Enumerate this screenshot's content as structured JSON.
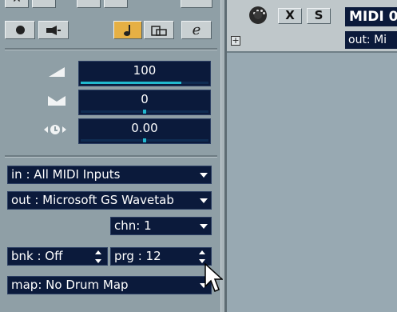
{
  "inspector": {
    "top_buttons": [
      {
        "name": "record-enable-icon",
        "glyph": "●"
      },
      {
        "name": "monitor-icon",
        "glyph": "▸"
      },
      {
        "name": "note-icon",
        "glyph": "♪"
      },
      {
        "name": "lock-icon",
        "glyph": "⊓"
      },
      {
        "name": "edit-icon",
        "glyph": "e"
      }
    ],
    "volume": {
      "value": "100",
      "level": 0.79
    },
    "pan": {
      "value": "0",
      "level": 0.5
    },
    "delay": {
      "value": "0.00",
      "level": 0.5
    },
    "input": {
      "label": "in : All MIDI Inputs"
    },
    "output": {
      "label": "out : Microsoft GS Wavetab"
    },
    "channel": {
      "label": "chn:  1"
    },
    "bank": {
      "label": "bnk : Off"
    },
    "program": {
      "label": "prg : 12"
    },
    "map": {
      "label": "map: No Drum Map"
    }
  },
  "track": {
    "mute_label": "X",
    "solo_label": "S",
    "name": "MIDI 0",
    "output": "out: Mi",
    "expand_label": "+"
  },
  "colors": {
    "inspector_bg": "#8f9fa6",
    "field_bg": "#0b1a3b",
    "accent": "#21b9cf",
    "active_button": "#e6b044"
  }
}
